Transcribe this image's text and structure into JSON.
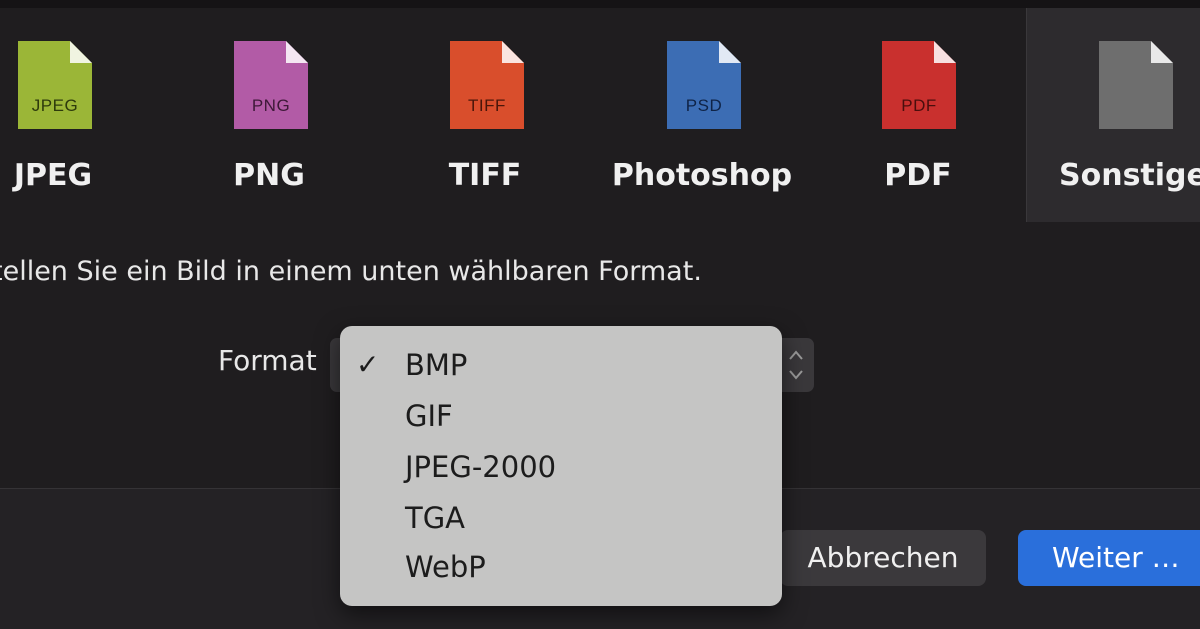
{
  "formats": [
    {
      "name": "JPEG",
      "icon_label": "JPEG",
      "icon": "jpeg-file-icon",
      "color": "#9bb637"
    },
    {
      "name": "PNG",
      "icon_label": "PNG",
      "icon": "png-file-icon",
      "color": "#b25ba6"
    },
    {
      "name": "TIFF",
      "icon_label": "TIFF",
      "icon": "tiff-file-icon",
      "color": "#d94e2c"
    },
    {
      "name": "Photoshop",
      "icon_label": "PSD",
      "icon": "psd-file-icon",
      "color": "#3c6db4"
    },
    {
      "name": "PDF",
      "icon_label": "PDF",
      "icon": "pdf-file-icon",
      "color": "#c9302e"
    },
    {
      "name": "Sonstige",
      "icon_label": "",
      "icon": "generic-file-icon",
      "color": "#6e6e6e",
      "selected": true
    }
  ],
  "description": "tellen Sie ein Bild in einem unten wählbaren Format.",
  "format_label": "Format",
  "format_menu": {
    "items": [
      "BMP",
      "GIF",
      "JPEG-2000",
      "TGA",
      "WebP"
    ],
    "selected": "BMP"
  },
  "buttons": {
    "cancel": "Abbrechen",
    "continue": "Weiter …"
  },
  "colors": {
    "background": "#1f1d1f",
    "menu_background": "#c5c5c4",
    "primary_button": "#2a6fdb",
    "secondary_button": "#3b393c"
  }
}
